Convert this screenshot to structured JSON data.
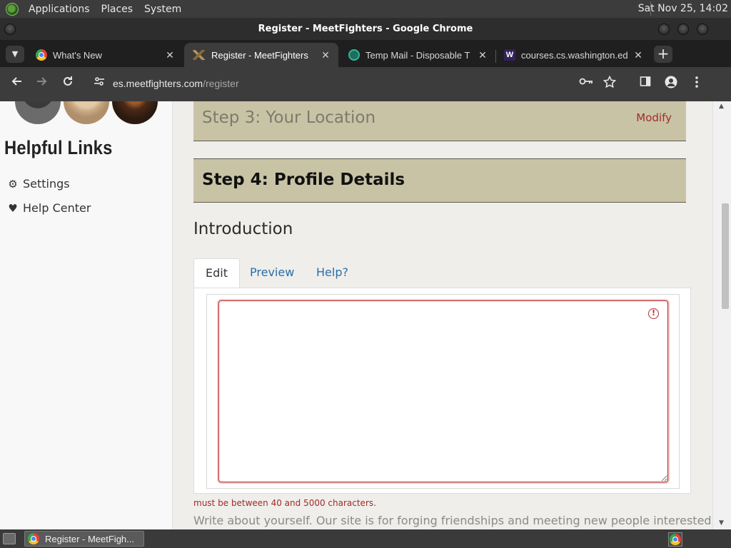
{
  "top_panel": {
    "menus": [
      "Applications",
      "Places",
      "System"
    ],
    "clock": "Sat Nov 25, 14:02"
  },
  "window": {
    "title": "Register - MeetFighters - Google Chrome"
  },
  "tabs": [
    {
      "label": "What's New",
      "icon": "chrome-icon",
      "active": false
    },
    {
      "label": "Register - MeetFighters",
      "icon": "meetfighters-icon",
      "active": true
    },
    {
      "label": "Temp Mail - Disposable T",
      "icon": "tempmail-icon",
      "active": false
    },
    {
      "label": "courses.cs.washington.ed",
      "icon": "washington-w-icon",
      "active": false
    }
  ],
  "address_bar": {
    "host": "es.meetfighters.com",
    "path": "/register"
  },
  "sidebar": {
    "heading": "Helpful Links",
    "links": [
      {
        "label": "Settings",
        "icon": "gear-icon"
      },
      {
        "label": "Help Center",
        "icon": "heart-icon"
      }
    ]
  },
  "main": {
    "step3": {
      "title": "Step 3: Your Location",
      "action": "Modify"
    },
    "step4": {
      "title": "Step 4: Profile Details"
    },
    "section_title": "Introduction",
    "editor_tabs": [
      "Edit",
      "Preview",
      "Help?"
    ],
    "textarea_value": "",
    "error_message": "must be between 40 and 5000 characters.",
    "help_text": "Write about yourself. Our site is for forging friendships and meeting new people interested in"
  },
  "taskbar": {
    "task_label": "Register - MeetFigh..."
  },
  "colors": {
    "step_bar": "#c9c3a6",
    "error": "#b52b2b",
    "link": "#2a6ea7"
  }
}
